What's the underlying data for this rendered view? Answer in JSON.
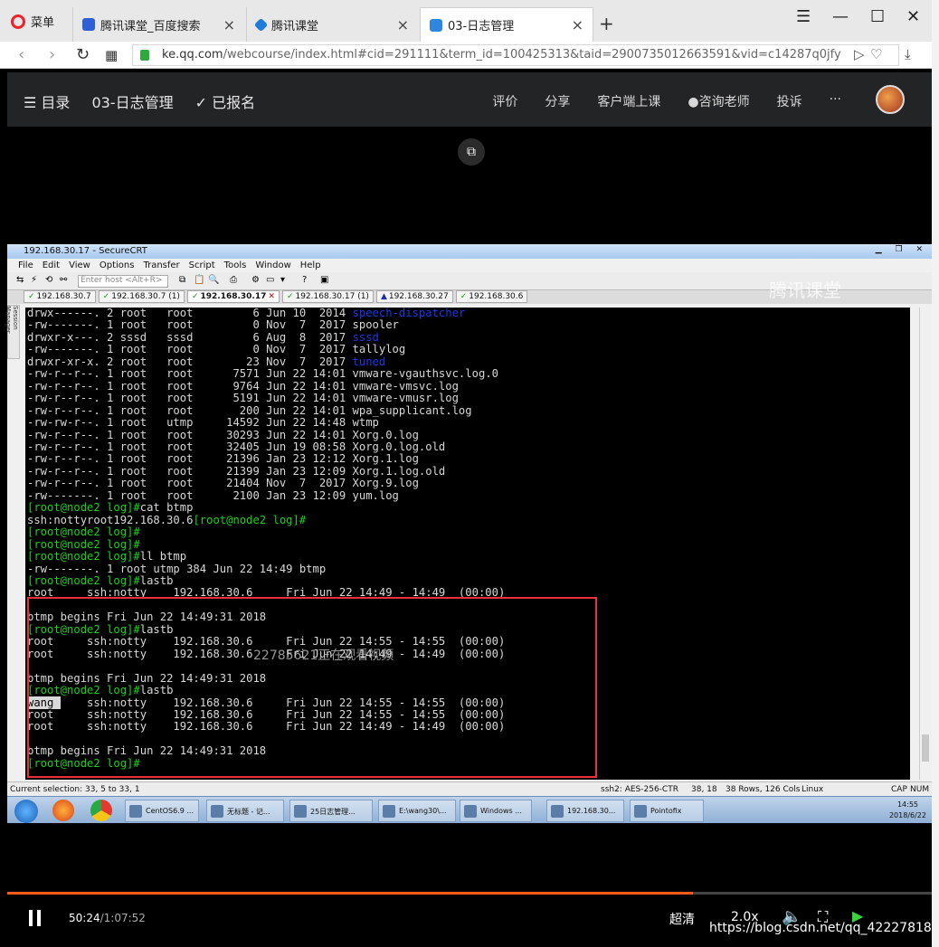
{
  "browser": {
    "menu_label": "菜单",
    "tabs": [
      {
        "label": "腾讯课堂_百度搜索",
        "active": false
      },
      {
        "label": "腾讯课堂",
        "active": false
      },
      {
        "label": "03-日志管理",
        "active": true
      }
    ],
    "url_host": "ke.qq.com",
    "url_path": "/webcourse/index.html#cid=291111&term_id=100425313&taid=2900735012663591&vid=c14287q0jfy"
  },
  "site_header": {
    "menu_label": "☰ 目录",
    "course_title": "03-日志管理",
    "enrolled_label": "✓ 已报名",
    "links": [
      "评价",
      "分享",
      "客户端上课",
      "咨询老师",
      "投诉",
      "···"
    ]
  },
  "securecrt": {
    "title": "192.168.30.17 - SecureCRT",
    "menu": [
      "File",
      "Edit",
      "View",
      "Options",
      "Transfer",
      "Script",
      "Tools",
      "Window",
      "Help"
    ],
    "host_placeholder": "Enter host <Alt+R>",
    "session_tabs": [
      {
        "label": "192.168.30.7",
        "icon": "check"
      },
      {
        "label": "192.168.30.7 (1)",
        "icon": "check"
      },
      {
        "label": "192.168.30.17",
        "icon": "check",
        "active": true
      },
      {
        "label": "192.168.30.17 (1)",
        "icon": "check"
      },
      {
        "label": "192.168.30.27",
        "icon": "warning"
      },
      {
        "label": "192.168.30.6",
        "icon": "check"
      }
    ],
    "session_manager_label": "Session Manager",
    "status": {
      "selection": "Current selection: 33, 5 to 33, 1",
      "cipher": "ssh2: AES-256-CTR",
      "position": "38, 18",
      "size": "38 Rows, 126 Cols",
      "os": "Linux",
      "caps": "CAP",
      "num": "NUM"
    }
  },
  "terminal_lines": [
    "drwx------. 2 root   root         6 Jun 10  2014 |b|speech-dispatcher",
    "-rw-------. 1 root   root         0 Nov  7  2017 spooler",
    "drwxr-x---. 2 sssd   sssd         6 Aug  8  2017 |b|sssd",
    "-rw-------. 1 root   root         0 Nov  7  2017 tallylog",
    "drwxr-xr-x. 2 root   root        23 Nov  7  2017 |b|tuned",
    "-rw-r--r--. 1 root   root      7571 Jun 22 14:01 vmware-vgauthsvc.log.0",
    "-rw-r--r--. 1 root   root      9764 Jun 22 14:01 vmware-vmsvc.log",
    "-rw-r--r--. 1 root   root      5191 Jun 22 14:01 vmware-vmusr.log",
    "-rw-r--r--. 1 root   root       200 Jun 22 14:01 wpa_supplicant.log",
    "-rw-rw-r--. 1 root   utmp     14592 Jun 22 14:48 wtmp",
    "-rw-r--r--. 1 root   root     30293 Jun 22 14:01 Xorg.0.log",
    "-rw-r--r--. 1 root   root     32405 Jun 19 08:58 Xorg.0.log.old",
    "-rw-r--r--. 1 root   root     21396 Jan 23 12:12 Xorg.1.log",
    "-rw-r--r--. 1 root   root     21399 Jan 23 12:09 Xorg.1.log.old",
    "-rw-r--r--. 1 root   root     21404 Nov  7  2017 Xorg.9.log",
    "-rw-------. 1 root   root      2100 Jan 23 12:09 yum.log",
    "|g|[root@node2 log]#|/|cat btmp",
    "\u0003ssh:nottyroot192.168.30.6|g|[root@node2 log]#",
    "|g|[root@node2 log]#",
    "|g|[root@node2 log]#",
    "|g|[root@node2 log]#|/|ll btmp",
    "-rw-------. 1 root utmp 384 Jun 22 14:49 btmp",
    "|g|[root@node2 log]#|/|lastb",
    "root     ssh:notty    192.168.30.6     Fri Jun 22 14:49 - 14:49  (00:00)",
    "",
    "btmp begins Fri Jun 22 14:49:31 2018",
    "|g|[root@node2 log]#|/|lastb",
    "root     ssh:notty    192.168.30.6     Fri Jun 22 14:55 - 14:55  (00:00)",
    "root     ssh:notty    192.168.30.6     Fri Jun 22 14:49 - 14:49  (00:00)",
    "",
    "btmp begins Fri Jun 22 14:49:31 2018",
    "|g|[root@node2 log]#|/|lastb",
    "|h|wang |/|    ssh:notty    192.168.30.6     Fri Jun 22 14:55 - 14:55  (00:00)",
    "root     ssh:notty    192.168.30.6     Fri Jun 22 14:55 - 14:55  (00:00)",
    "root     ssh:notty    192.168.30.6     Fri Jun 22 14:49 - 14:49  (00:00)",
    "",
    "btmp begins Fri Jun 22 14:49:31 2018",
    "|g|[root@node2 log]#"
  ],
  "watermark": "腾讯课堂",
  "viewer_overlay": "22785621正在观看视频",
  "taskbar": {
    "items": [
      "CentOS6.9 ...",
      "无标题 - 记...",
      "25日志管理...",
      "E:\\wang30\\...",
      "Windows ...",
      "192.168.30...",
      "Pointofix"
    ],
    "clock_time": "14:55",
    "clock_date": "2018/6/22"
  },
  "player": {
    "current_time": "50:24",
    "total_time": "/1:07:52",
    "progress": 0.742,
    "quality": "超清",
    "speed": "2.0x",
    "csdn_watermark": "https://blog.csdn.net/qq_42227818"
  },
  "colors": {
    "prompt_green": "#19d219",
    "dir_blue": "#1a38e8",
    "highlight_red": "#e8303a",
    "progress_orange": "#ff5a1a"
  }
}
